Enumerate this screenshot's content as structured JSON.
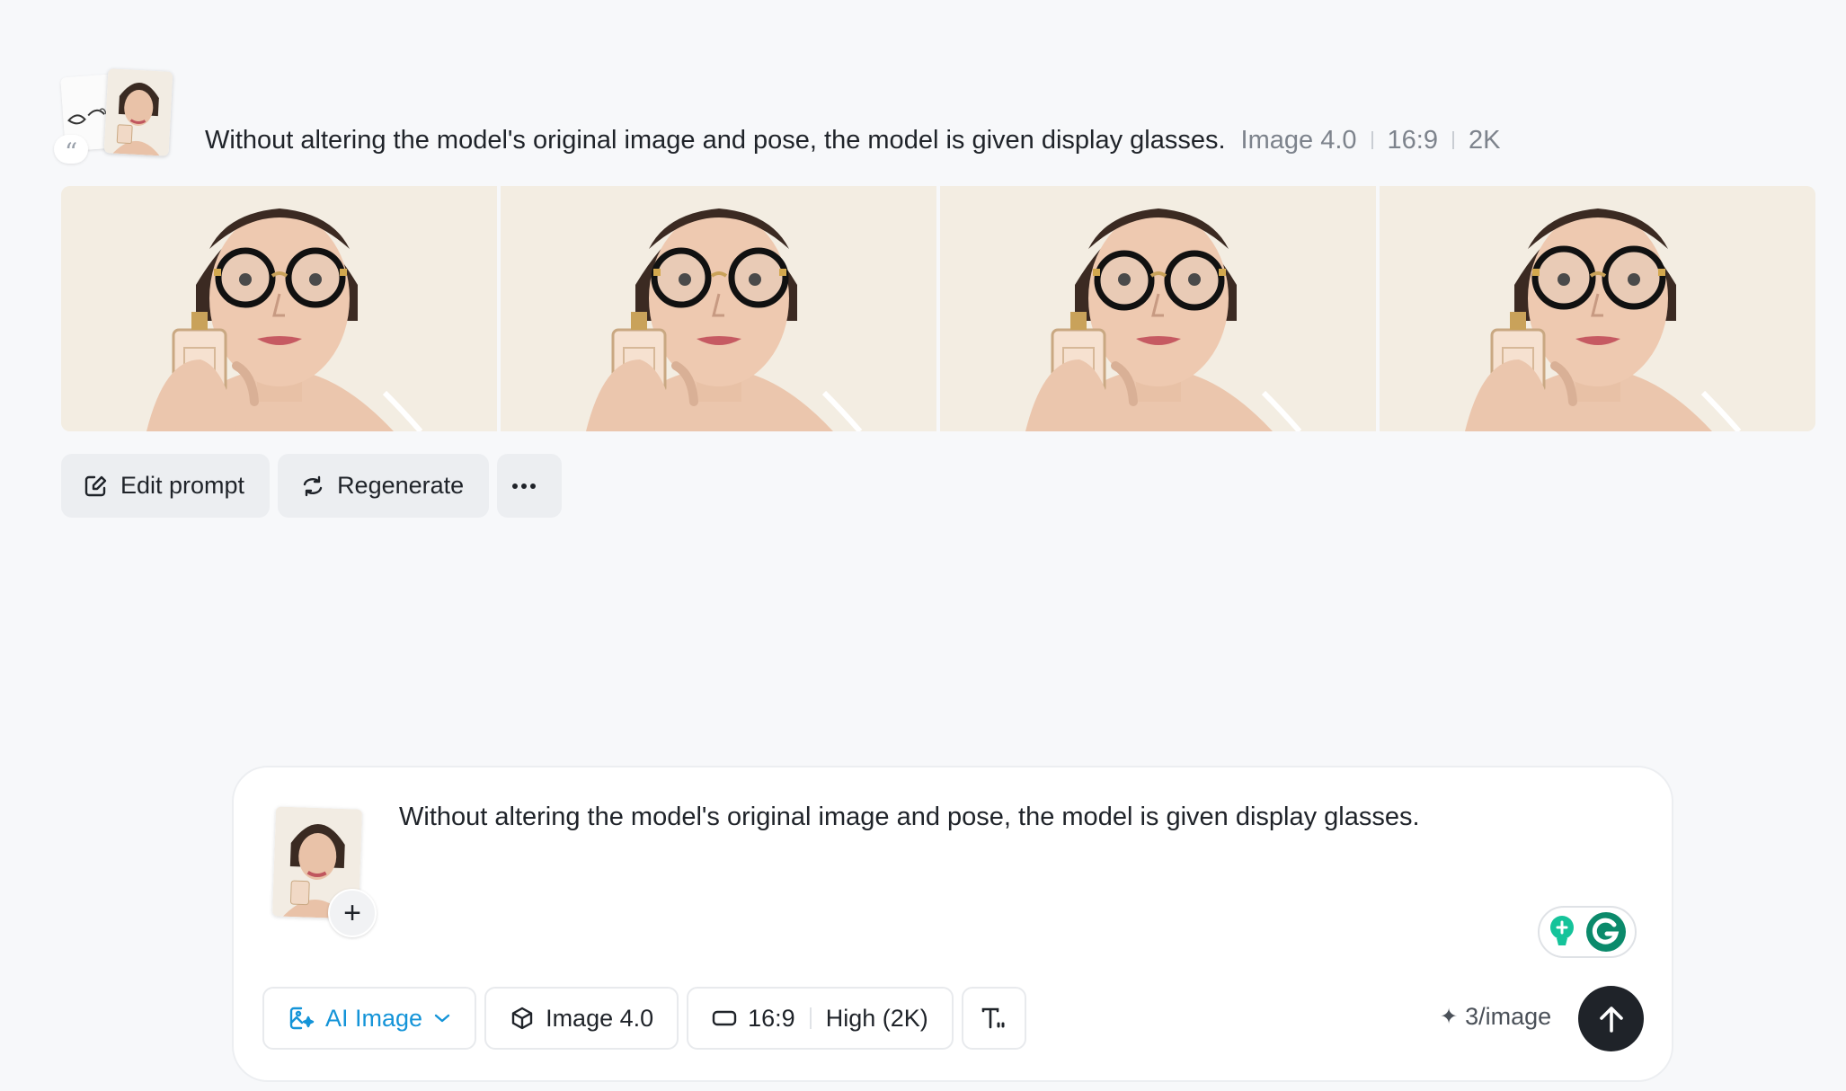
{
  "history": {
    "prompt": "Without altering the model's original image and pose, the model is given display glasses.",
    "model": "Image 4.0",
    "ratio": "16:9",
    "resolution": "2K",
    "quote_glyph": "“",
    "images": [
      {
        "alt": "generated-image-1"
      },
      {
        "alt": "generated-image-2"
      },
      {
        "alt": "generated-image-3"
      },
      {
        "alt": "generated-image-4"
      }
    ]
  },
  "actions": {
    "edit_label": "Edit prompt",
    "regenerate_label": "Regenerate",
    "more_label": "···"
  },
  "composer": {
    "prompt": "Without altering the model's original image and pose, the model is given display glasses.",
    "add_label": "+",
    "mode_label": "AI Image",
    "model_label": "Image 4.0",
    "ratio_label": "16:9",
    "quality_label": "High (2K)",
    "cost_label": "3/image",
    "cost_icon": "✦",
    "accent_color": "#1494d8",
    "send_color": "#1f2329"
  }
}
